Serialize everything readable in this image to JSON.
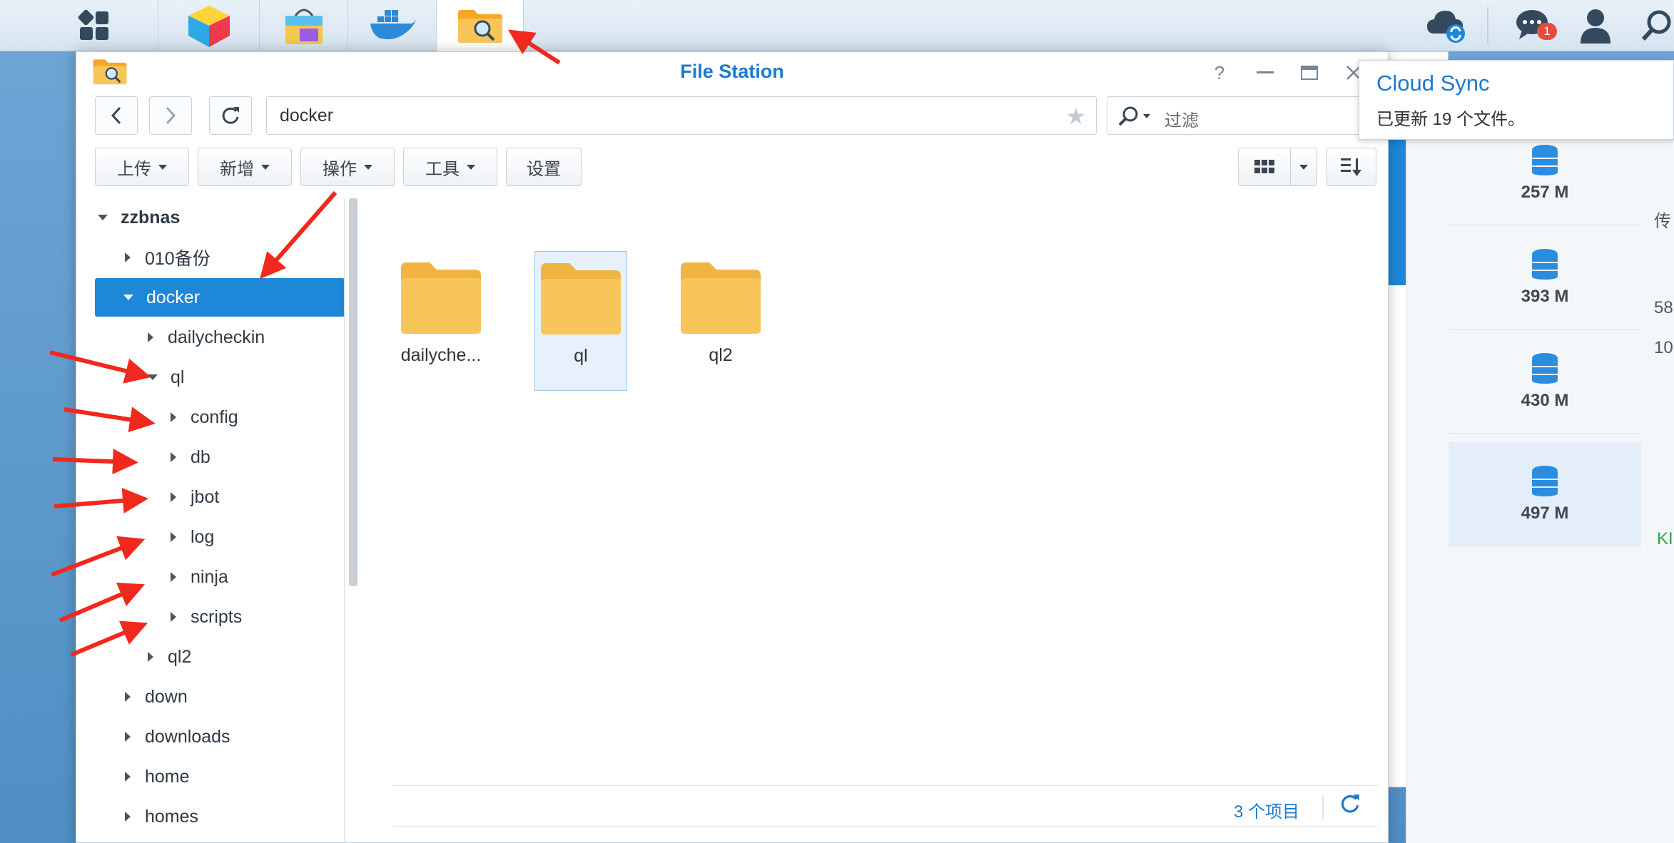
{
  "taskbar": {
    "notifications_badge": "1",
    "apps": [
      "main-menu",
      "package-center-app",
      "photo-app",
      "docker-app",
      "file-station-app"
    ]
  },
  "window": {
    "title": "File Station",
    "help_glyph": "?",
    "path": "docker",
    "filter_placeholder": "过滤",
    "toolbar": {
      "upload": "上传",
      "create": "新增",
      "action": "操作",
      "tools": "工具",
      "settings": "设置"
    },
    "tree": {
      "root": "zzbnas",
      "items": [
        {
          "label": "010备份"
        },
        {
          "label": "docker"
        },
        {
          "label": "dailycheckin"
        },
        {
          "label": "ql"
        },
        {
          "label": "config"
        },
        {
          "label": "db"
        },
        {
          "label": "jbot"
        },
        {
          "label": "log"
        },
        {
          "label": "ninja"
        },
        {
          "label": "scripts"
        },
        {
          "label": "ql2"
        },
        {
          "label": "down"
        },
        {
          "label": "downloads"
        },
        {
          "label": "home"
        },
        {
          "label": "homes"
        }
      ]
    },
    "files": [
      {
        "label": "dailyche..."
      },
      {
        "label": "ql"
      },
      {
        "label": "ql2"
      }
    ],
    "status": {
      "count": "3 个项目"
    }
  },
  "notification": {
    "title": "Cloud Sync",
    "text": "已更新 19 个文件。"
  },
  "background_panel": {
    "stats": [
      "257 M",
      "393 M",
      "430 M",
      "497 M"
    ],
    "fragments": [
      "传",
      "58",
      "10",
      "KI"
    ]
  },
  "colors": {
    "accent": "#1b7ad2",
    "selection": "#1d87d8",
    "folder": "#f7c55a",
    "annotation_arrow": "#f0281e"
  }
}
